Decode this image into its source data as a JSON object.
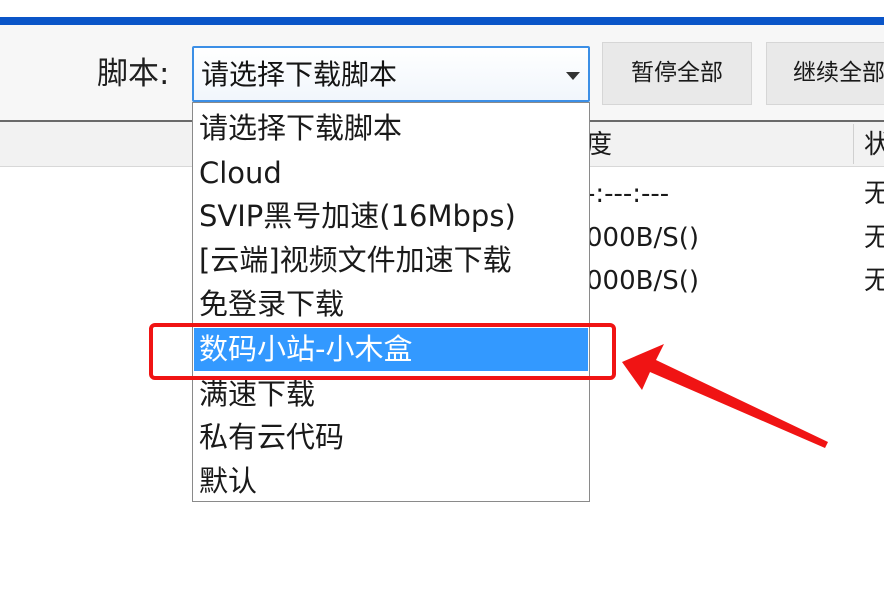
{
  "toolbar": {
    "script_label": "脚本:",
    "select_value": "请选择下载脚本",
    "pause_all_label": "暂停全部",
    "resume_all_label": "继续全部"
  },
  "table": {
    "headers": [
      "度",
      "状"
    ],
    "rows": [
      [
        "-:---:---",
        "无"
      ],
      [
        "000B/S()",
        "无"
      ],
      [
        "000B/S()",
        "无"
      ]
    ]
  },
  "dropdown": {
    "options": [
      "请选择下载脚本",
      "Cloud",
      "SVIP黑号加速(16Mbps)",
      "[云端]视频文件加速下载",
      "免登录下载",
      "数码小站-小木盒",
      "满速下载",
      "私有云代码",
      "默认"
    ],
    "selected_index": 5
  },
  "colors": {
    "accent": "#0a55c8",
    "selection": "#3399ff",
    "annotation": "#f01414"
  }
}
